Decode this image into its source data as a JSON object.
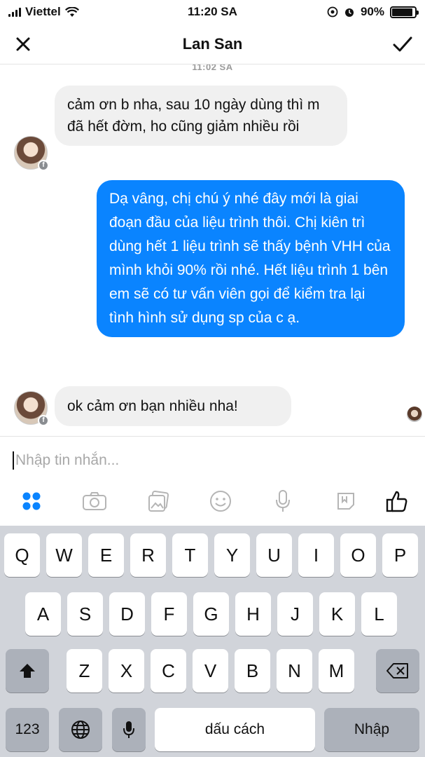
{
  "status": {
    "carrier": "Viettel",
    "time": "11:20 SA",
    "battery": "90%",
    "battery_level": 0.9
  },
  "header": {
    "title": "Lan San"
  },
  "chat": {
    "timestamp": "11:02 SA",
    "messages": [
      {
        "from": "contact",
        "text": "cảm ơn b nha, sau 10 ngày dùng thì m đã hết đờm, ho cũng giảm nhiều rồi"
      },
      {
        "from": "me",
        "text": "Dạ vâng, chị chú ý nhé đây mới là giai đoạn đầu của liệu trình thôi. Chị kiên trì dùng hết 1 liệu trình sẽ thấy bệnh VHH của mình khỏi 90% rồi nhé. Hết liệu trình 1 bên em sẽ có tư vấn viên gọi để kiểm tra lại tình hình sử dụng sp của c ạ."
      },
      {
        "from": "contact",
        "text": "ok cảm ơn bạn nhiều nha!"
      }
    ]
  },
  "composer": {
    "placeholder": "Nhập tin nhắn...",
    "tools": [
      "apps-grid-icon",
      "camera-icon",
      "photo-icon",
      "emoji-icon",
      "microphone-icon",
      "sticker-icon",
      "thumbs-up-icon"
    ]
  },
  "keyboard": {
    "row1": [
      "Q",
      "W",
      "E",
      "R",
      "T",
      "Y",
      "U",
      "I",
      "O",
      "P"
    ],
    "row2": [
      "A",
      "S",
      "D",
      "F",
      "G",
      "H",
      "J",
      "K",
      "L"
    ],
    "row3": [
      "Z",
      "X",
      "C",
      "V",
      "B",
      "N",
      "M"
    ],
    "numbers": "123",
    "space": "dấu cách",
    "return": "Nhập"
  },
  "colors": {
    "accent": "#0a84ff",
    "incoming_bubble": "#f0f0f0",
    "keyboard_bg": "#d1d4da"
  }
}
